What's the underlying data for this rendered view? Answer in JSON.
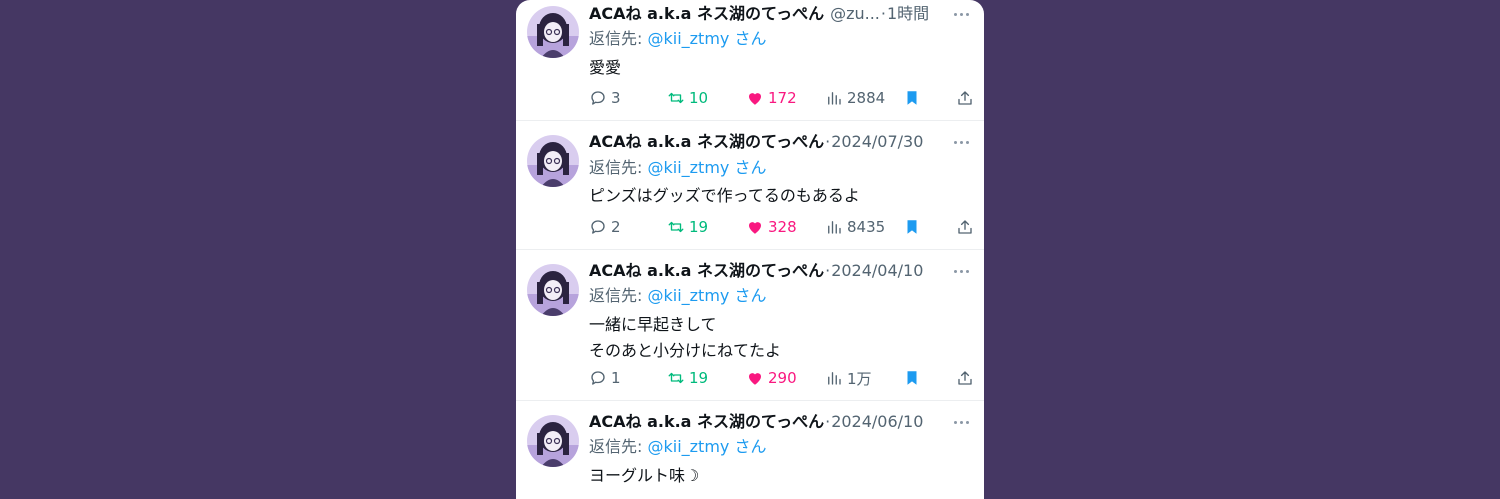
{
  "reply_prefix": "返信先:",
  "tweets": [
    {
      "name": "ACAね a.k.a ネス湖のてっぺん",
      "handle": "@zu...",
      "dot": "·",
      "time": "1時間",
      "reply_to": "@kii_ztmy さん",
      "text": "愛愛",
      "replies": "3",
      "retweets": "10",
      "likes": "172",
      "views": "2884"
    },
    {
      "name": "ACAね a.k.a ネス湖のてっぺん",
      "handle": "",
      "dot": "·",
      "time": "2024/07/30",
      "reply_to": "@kii_ztmy さん",
      "text": "ピンズはグッズで作ってるのもあるよ",
      "replies": "2",
      "retweets": "19",
      "likes": "328",
      "views": "8435"
    },
    {
      "name": "ACAね a.k.a ネス湖のてっぺん",
      "handle": "",
      "dot": "·",
      "time": "2024/04/10",
      "reply_to": "@kii_ztmy さん",
      "text": "一緒に早起きして\nそのあと小分けにねてたよ",
      "replies": "1",
      "retweets": "19",
      "likes": "290",
      "views": "1万"
    },
    {
      "name": "ACAね a.k.a ネス湖のてっぺん",
      "handle": "",
      "dot": "·",
      "time": "2024/06/10",
      "reply_to": "@kii_ztmy さん",
      "text": "ヨーグルト味☽"
    }
  ],
  "colors": {
    "background": "#453763",
    "link": "#1d9bf0",
    "retweet": "#00ba7c",
    "like": "#f91880",
    "muted": "#536471"
  },
  "icons": [
    "avatar",
    "more-icon",
    "reply-icon",
    "retweet-icon",
    "like-icon",
    "views-icon",
    "bookmark-icon",
    "share-icon"
  ]
}
